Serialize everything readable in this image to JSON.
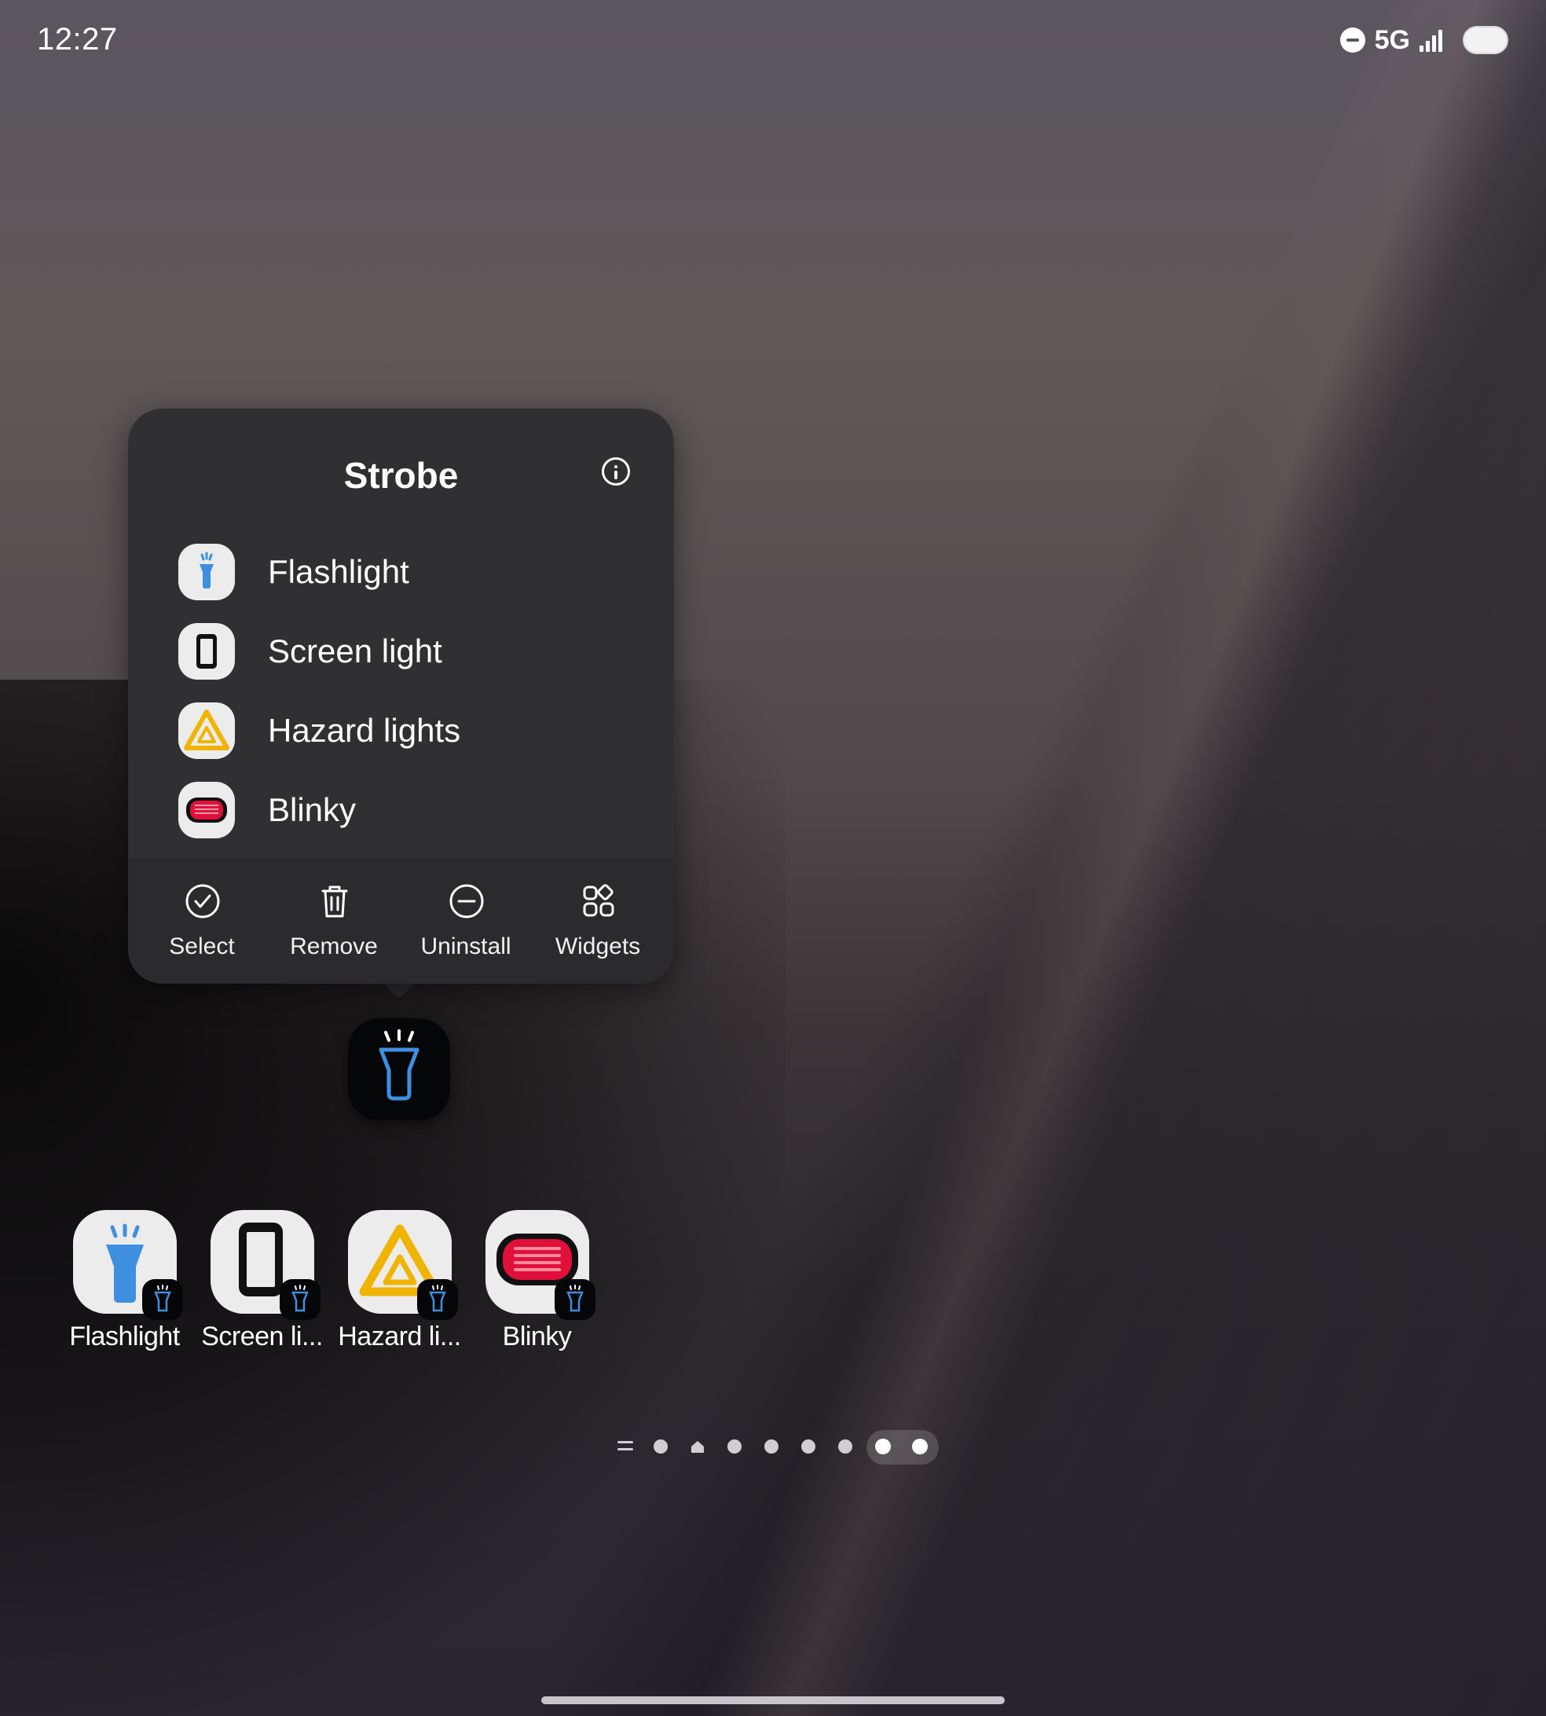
{
  "status_bar": {
    "time": "12:27",
    "network": "5G",
    "icons": [
      "dnd-icon",
      "signal-icon",
      "battery-icon"
    ]
  },
  "popup": {
    "title": "Strobe",
    "shortcuts": [
      {
        "label": "Flashlight",
        "icon": "flashlight-icon"
      },
      {
        "label": "Screen light",
        "icon": "screen-light-icon"
      },
      {
        "label": "Hazard lights",
        "icon": "hazard-icon"
      },
      {
        "label": "Blinky",
        "icon": "blinky-icon"
      }
    ],
    "actions": [
      {
        "label": "Select",
        "icon": "check-circle-icon"
      },
      {
        "label": "Remove",
        "icon": "trash-icon"
      },
      {
        "label": "Uninstall",
        "icon": "minus-circle-icon"
      },
      {
        "label": "Widgets",
        "icon": "widgets-icon"
      }
    ]
  },
  "home": {
    "apps": [
      {
        "label": "Flashlight",
        "icon": "flashlight-icon"
      },
      {
        "label": "Screen li...",
        "icon": "screen-light-icon"
      },
      {
        "label": "Hazard li...",
        "icon": "hazard-icon"
      },
      {
        "label": "Blinky",
        "icon": "blinky-icon"
      }
    ],
    "pages": {
      "count": 8,
      "active_pages": [
        7,
        8
      ]
    }
  },
  "colors": {
    "flashlight_blue": "#3f8fe0",
    "hazard_yellow": "#f0b400",
    "blinky_red": "#e0103a",
    "popup_bg": "#303032"
  }
}
